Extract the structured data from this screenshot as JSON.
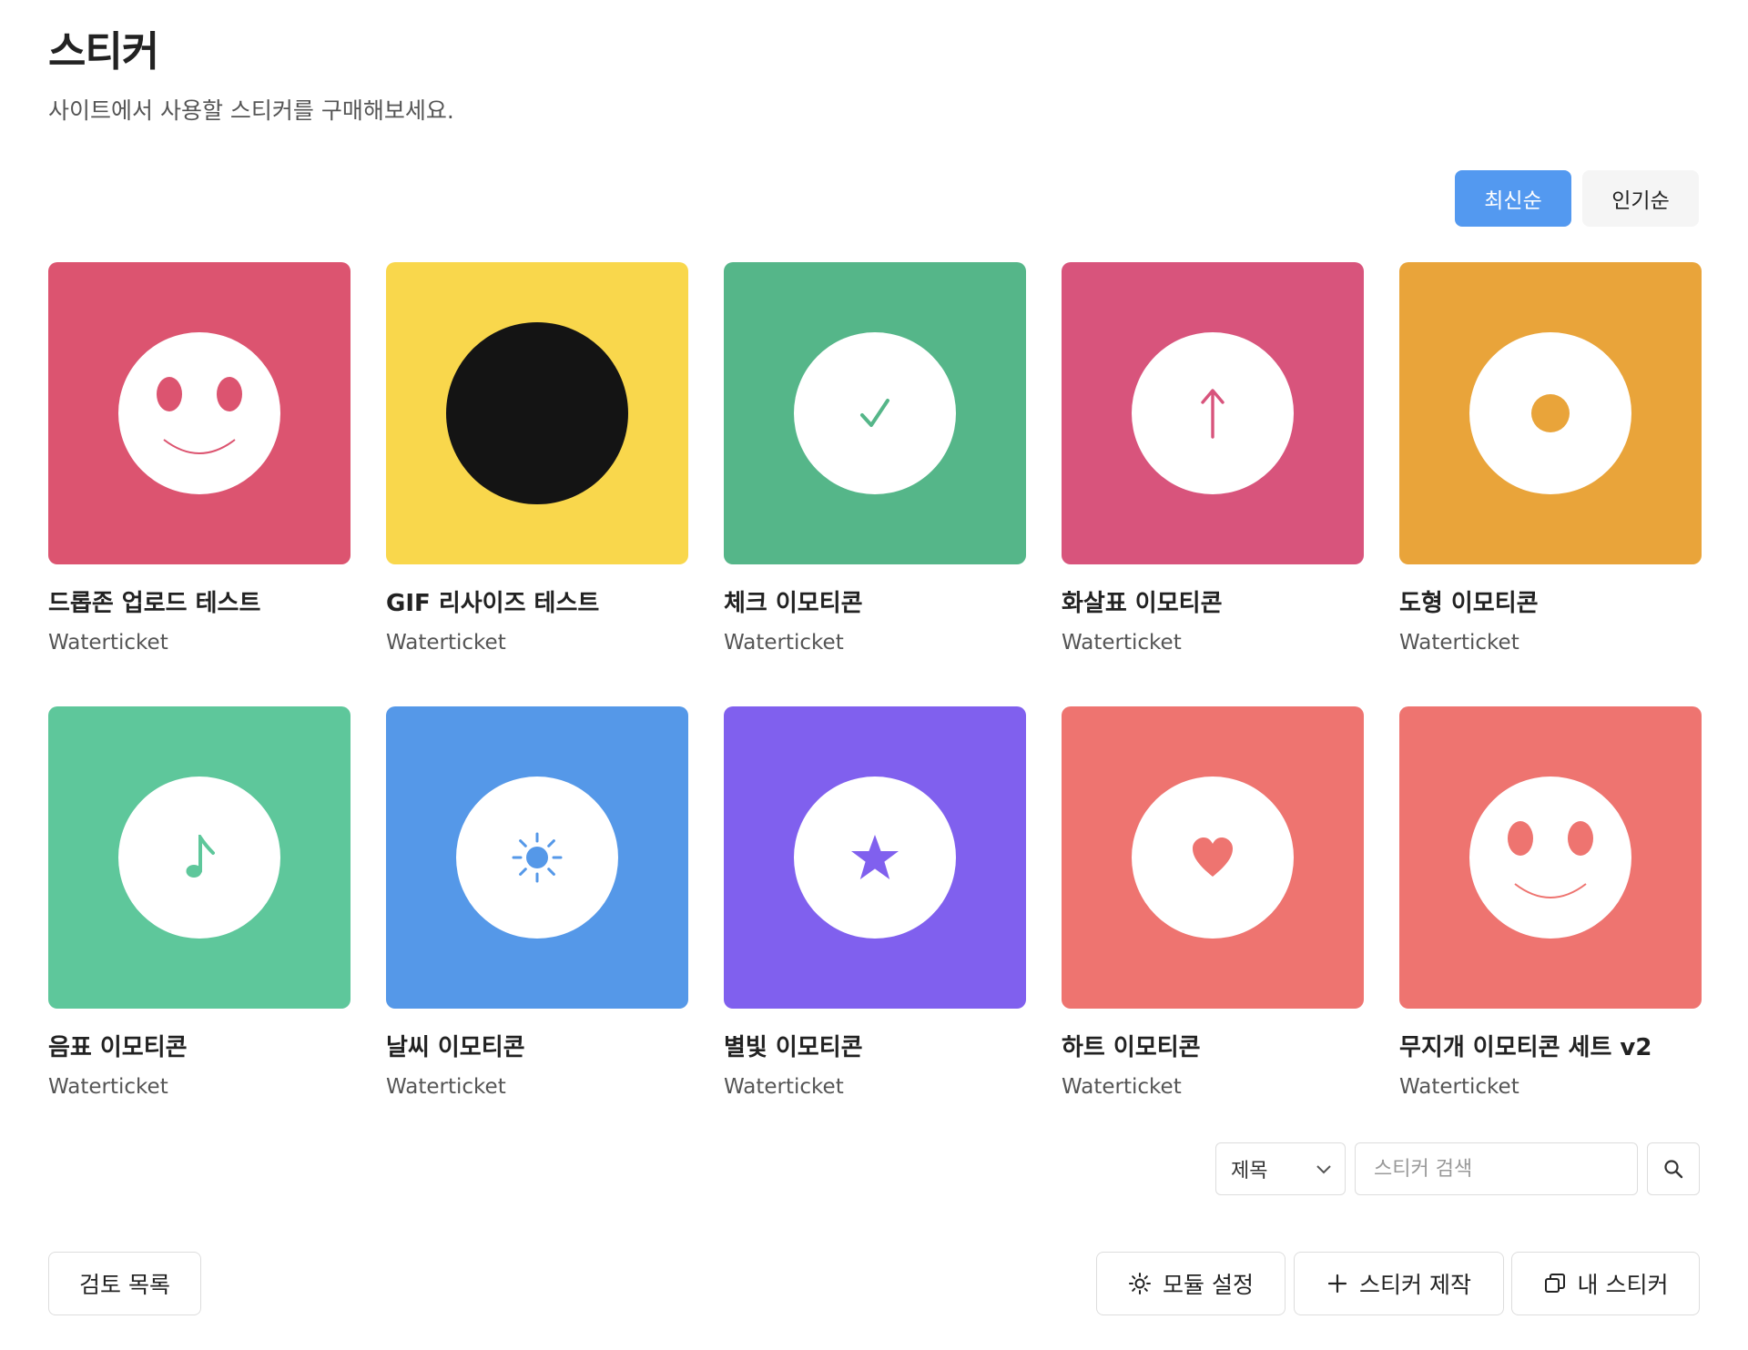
{
  "header": {
    "title": "스티커",
    "subtitle": "사이트에서 사용할 스티커를 구매해보세요."
  },
  "sort": {
    "latest_label": "최신순",
    "popular_label": "인기순",
    "active": "latest"
  },
  "stickers": [
    {
      "title": "드롭존 업로드 테스트",
      "author": "Waterticket",
      "bg": "#dc5470",
      "icon": "smiley-icon",
      "accent": "#dc5470"
    },
    {
      "title": "GIF 리사이즈 테스트",
      "author": "Waterticket",
      "bg": "#f9d74c",
      "icon": "black-circle-icon",
      "accent": "#141414"
    },
    {
      "title": "체크 이모티콘",
      "author": "Waterticket",
      "bg": "#55b689",
      "icon": "check-icon",
      "accent": "#55b689"
    },
    {
      "title": "화살표 이모티콘",
      "author": "Waterticket",
      "bg": "#d8547c",
      "icon": "arrow-up-icon",
      "accent": "#d8547c"
    },
    {
      "title": "도형 이모티콘",
      "author": "Waterticket",
      "bg": "#e9a43a",
      "icon": "dot-icon",
      "accent": "#e9a43a"
    },
    {
      "title": "음표 이모티콘",
      "author": "Waterticket",
      "bg": "#5ec79b",
      "icon": "music-note-icon",
      "accent": "#5ec79b"
    },
    {
      "title": "날씨 이모티콘",
      "author": "Waterticket",
      "bg": "#5598e8",
      "icon": "sun-icon",
      "accent": "#5598e8"
    },
    {
      "title": "별빛 이모티콘",
      "author": "Waterticket",
      "bg": "#8060ee",
      "icon": "star-icon",
      "accent": "#8060ee"
    },
    {
      "title": "하트 이모티콘",
      "author": "Waterticket",
      "bg": "#ee7470",
      "icon": "heart-icon",
      "accent": "#ee7470"
    },
    {
      "title": "무지개 이모티콘 세트 v2",
      "author": "Waterticket",
      "bg": "#ee7470",
      "icon": "smiley-icon",
      "accent": "#ee7470"
    }
  ],
  "search": {
    "field_selected": "제목",
    "placeholder": "스티커 검색"
  },
  "footer": {
    "review_list_label": "검토 목록",
    "module_settings_label": "모듈 설정",
    "create_sticker_label": "스티커 제작",
    "my_stickers_label": "내 스티커"
  },
  "colors": {
    "accent": "#5399f0",
    "border": "#dddddd"
  }
}
